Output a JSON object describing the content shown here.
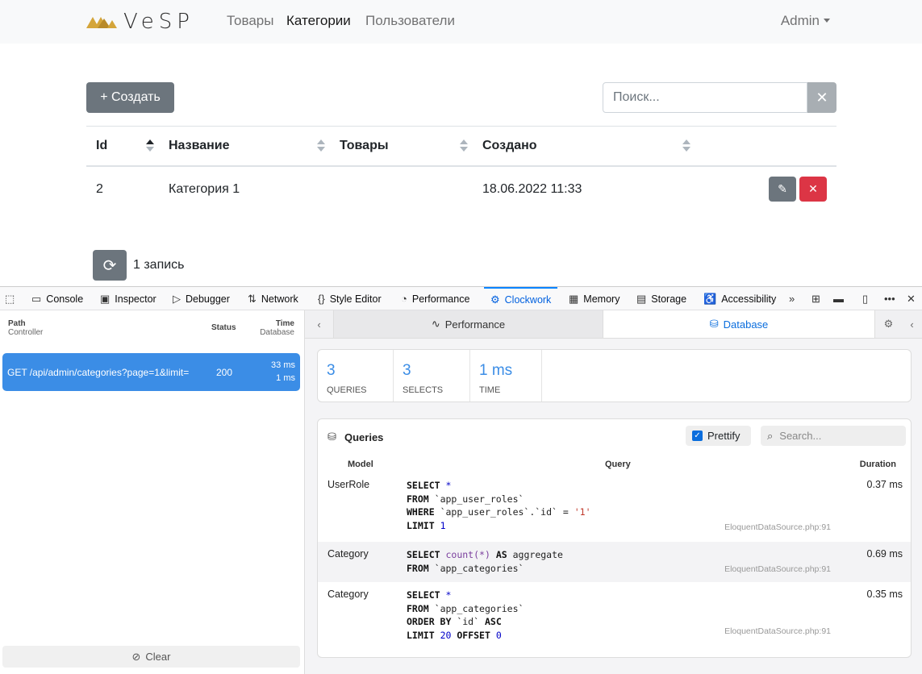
{
  "navbar": {
    "brand": "VeSP",
    "links": [
      "Товары",
      "Категории",
      "Пользователи"
    ],
    "user": "Admin"
  },
  "toolbar": {
    "create_label": "+ Создать",
    "search_placeholder": "Поиск...",
    "clear_symbol": "✕"
  },
  "table": {
    "headers": [
      "Id",
      "Название",
      "Товары",
      "Создано"
    ],
    "rows": [
      {
        "id": "2",
        "name": "Категория 1",
        "products": "",
        "created": "18.06.2022 11:33"
      }
    ]
  },
  "footer": {
    "count_text": "1 запись"
  },
  "devtools": {
    "tabs": [
      "Console",
      "Inspector",
      "Debugger",
      "Network",
      "Style Editor",
      "Performance",
      "Clockwork",
      "Memory",
      "Storage",
      "Accessibility"
    ],
    "active_tab": "Clockwork"
  },
  "clockwork": {
    "left_headers": {
      "path": "Path",
      "controller": "Controller",
      "status": "Status",
      "time": "Time",
      "database": "Database"
    },
    "request": {
      "method_path": "GET /api/admin/categories?page=1&limit=",
      "status": "200",
      "time": "33 ms",
      "db": "1 ms"
    },
    "clear_label": "Clear",
    "tabs": {
      "performance": "Performance",
      "database": "Database"
    },
    "stats": [
      {
        "value": "3",
        "label": "QUERIES"
      },
      {
        "value": "3",
        "label": "SELECTS"
      },
      {
        "value": "1 ms",
        "label": "TIME"
      }
    ],
    "queries_title": "Queries",
    "prettify_label": "Prettify",
    "search_placeholder": "Search...",
    "columns": {
      "model": "Model",
      "query": "Query",
      "duration": "Duration"
    },
    "queries": [
      {
        "model": "UserRole",
        "duration": "0.37 ms",
        "source": "EloquentDataSource.php:91"
      },
      {
        "model": "Category",
        "duration": "0.69 ms",
        "source": "EloquentDataSource.php:91"
      },
      {
        "model": "Category",
        "duration": "0.35 ms",
        "source": "EloquentDataSource.php:91"
      }
    ],
    "sql": {
      "q1": {
        "l1": "SELECT",
        "l1b": "*",
        "l2": "FROM",
        "l2b": "`app_user_roles`",
        "l3": "WHERE",
        "l3b": "`app_user_roles`.`id` =",
        "l3c": "'1'",
        "l4": "LIMIT",
        "l4b": "1"
      },
      "q2": {
        "l1": "SELECT",
        "l1b": "count",
        "l1c": "(*)",
        "l1d": "AS",
        "l1e": "aggregate",
        "l2": "FROM",
        "l2b": "`app_categories`"
      },
      "q3": {
        "l1": "SELECT",
        "l1b": "*",
        "l2": "FROM",
        "l2b": "`app_categories`",
        "l3": "ORDER BY",
        "l3b": "`id`",
        "l3c": "ASC",
        "l4": "LIMIT",
        "l4b": "20",
        "l4c": "OFFSET",
        "l4d": "0"
      }
    }
  }
}
